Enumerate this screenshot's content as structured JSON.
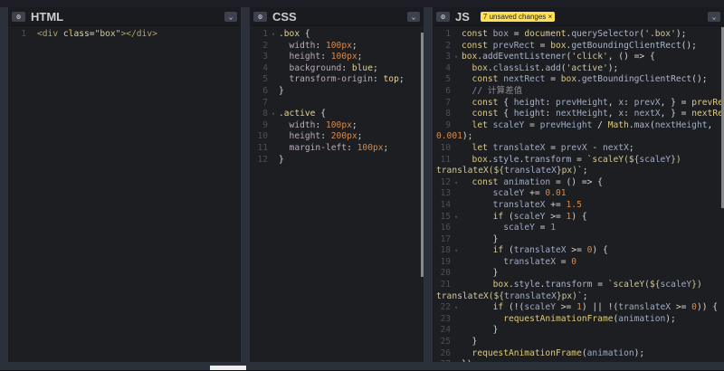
{
  "panels": [
    {
      "id": "html",
      "title": "HTML",
      "lines": [
        [
          [
            "tag",
            "<div "
          ],
          [
            "at",
            "class"
          ],
          [
            "txt",
            "="
          ],
          [
            "s",
            "\"box\""
          ],
          [
            "tag",
            "></div>"
          ]
        ]
      ]
    },
    {
      "id": "css",
      "title": "CSS",
      "lines": [
        [
          [
            "at",
            ".box"
          ],
          [
            "txt",
            " {"
          ]
        ],
        [
          [
            "p",
            "  width"
          ],
          [
            "txt",
            ": "
          ],
          [
            "n",
            "100px"
          ],
          [
            "txt",
            ";"
          ]
        ],
        [
          [
            "p",
            "  height"
          ],
          [
            "txt",
            ": "
          ],
          [
            "n",
            "100px"
          ],
          [
            "txt",
            ";"
          ]
        ],
        [
          [
            "p",
            "  background"
          ],
          [
            "txt",
            ": "
          ],
          [
            "at",
            "blue"
          ],
          [
            "txt",
            ";"
          ]
        ],
        [
          [
            "p",
            "  transform-origin"
          ],
          [
            "txt",
            ": "
          ],
          [
            "at",
            "top"
          ],
          [
            "txt",
            ";"
          ]
        ],
        [
          [
            "txt",
            "}"
          ]
        ],
        [],
        [
          [
            "at",
            ".active"
          ],
          [
            "txt",
            " {"
          ]
        ],
        [
          [
            "p",
            "  width"
          ],
          [
            "txt",
            ": "
          ],
          [
            "n",
            "100px"
          ],
          [
            "txt",
            ";"
          ]
        ],
        [
          [
            "p",
            "  height"
          ],
          [
            "txt",
            ": "
          ],
          [
            "n",
            "200px"
          ],
          [
            "txt",
            ";"
          ]
        ],
        [
          [
            "p",
            "  margin-left"
          ],
          [
            "txt",
            ": "
          ],
          [
            "n",
            "100px"
          ],
          [
            "txt",
            ";"
          ]
        ],
        [
          [
            "txt",
            "}"
          ]
        ]
      ],
      "folds": [
        1,
        8
      ]
    },
    {
      "id": "js",
      "title": "JS",
      "badge": "7 unsaved changes ×",
      "lines": [
        [
          [
            "kw",
            "const "
          ],
          [
            "v",
            "box"
          ],
          [
            "txt",
            " = "
          ],
          [
            "kw",
            "document"
          ],
          [
            "txt",
            "."
          ],
          [
            "m",
            "querySelector"
          ],
          [
            "txt",
            "("
          ],
          [
            "s",
            "'.box'"
          ],
          [
            "txt",
            ");"
          ]
        ],
        [
          [
            "kw",
            "const "
          ],
          [
            "v",
            "prevRect"
          ],
          [
            "txt",
            " = "
          ],
          [
            "kw",
            "box"
          ],
          [
            "txt",
            "."
          ],
          [
            "m",
            "getBoundingClientRect"
          ],
          [
            "txt",
            "();"
          ]
        ],
        [
          [
            "kw",
            "box"
          ],
          [
            "txt",
            "."
          ],
          [
            "m",
            "addEventListener"
          ],
          [
            "txt",
            "("
          ],
          [
            "s",
            "'click'"
          ],
          [
            "txt",
            ", () => {"
          ]
        ],
        [
          [
            "kw",
            "  box"
          ],
          [
            "txt",
            "."
          ],
          [
            "m",
            "classList"
          ],
          [
            "txt",
            "."
          ],
          [
            "m",
            "add"
          ],
          [
            "txt",
            "("
          ],
          [
            "s",
            "'active'"
          ],
          [
            "txt",
            ");"
          ]
        ],
        [
          [
            "kw",
            "  const "
          ],
          [
            "v",
            "nextRect"
          ],
          [
            "txt",
            " = "
          ],
          [
            "kw",
            "box"
          ],
          [
            "txt",
            "."
          ],
          [
            "m",
            "getBoundingClientRect"
          ],
          [
            "txt",
            "();"
          ]
        ],
        [
          [
            "c",
            "  // 计算差值"
          ]
        ],
        [
          [
            "kw",
            "  const "
          ],
          [
            "txt",
            "{ "
          ],
          [
            "m",
            "height"
          ],
          [
            "txt",
            ": "
          ],
          [
            "v",
            "prevHeight"
          ],
          [
            "txt",
            ", "
          ],
          [
            "m",
            "x"
          ],
          [
            "txt",
            ": "
          ],
          [
            "v",
            "prevX"
          ],
          [
            "txt",
            ", } = "
          ],
          [
            "kw",
            "prevRect"
          ],
          [
            "txt",
            ";"
          ]
        ],
        [
          [
            "kw",
            "  const "
          ],
          [
            "txt",
            "{ "
          ],
          [
            "m",
            "height"
          ],
          [
            "txt",
            ": "
          ],
          [
            "v",
            "nextHeight"
          ],
          [
            "txt",
            ", "
          ],
          [
            "m",
            "x"
          ],
          [
            "txt",
            ": "
          ],
          [
            "v",
            "nextX"
          ],
          [
            "txt",
            ", } = "
          ],
          [
            "kw",
            "nextRect"
          ],
          [
            "txt",
            ";"
          ]
        ],
        [
          [
            "kw",
            "  let "
          ],
          [
            "v",
            "scaleY"
          ],
          [
            "txt",
            " = "
          ],
          [
            "v",
            "prevHeight"
          ],
          [
            "txt",
            " / "
          ],
          [
            "kw",
            "Math"
          ],
          [
            "txt",
            "."
          ],
          [
            "m",
            "max"
          ],
          [
            "txt",
            "("
          ],
          [
            "v",
            "nextHeight"
          ],
          [
            "txt",
            ","
          ]
        ],
        [
          [
            "n",
            "0.001"
          ],
          [
            "txt",
            ");"
          ]
        ],
        [
          [
            "kw",
            "  let "
          ],
          [
            "v",
            "translateX"
          ],
          [
            "txt",
            " = "
          ],
          [
            "v",
            "prevX"
          ],
          [
            "txt",
            " - "
          ],
          [
            "v",
            "nextX"
          ],
          [
            "txt",
            ";"
          ]
        ],
        [
          [
            "kw",
            "  box"
          ],
          [
            "txt",
            "."
          ],
          [
            "m",
            "style"
          ],
          [
            "txt",
            "."
          ],
          [
            "m",
            "transform"
          ],
          [
            "txt",
            " = "
          ],
          [
            "s",
            "`scaleY(${"
          ],
          [
            "v",
            "scaleY"
          ],
          [
            "s",
            "})"
          ]
        ],
        [
          [
            "s",
            "translateX(${"
          ],
          [
            "v",
            "translateX"
          ],
          [
            "s",
            "}px)`"
          ],
          [
            "txt",
            ";"
          ]
        ],
        [
          [
            "kw",
            "  const "
          ],
          [
            "v",
            "animation"
          ],
          [
            "txt",
            " = () => {"
          ]
        ],
        [
          [
            "v",
            "      scaleY"
          ],
          [
            "txt",
            " += "
          ],
          [
            "n",
            "0.01"
          ]
        ],
        [
          [
            "v",
            "      translateX"
          ],
          [
            "txt",
            " += "
          ],
          [
            "n",
            "1.5"
          ]
        ],
        [
          [
            "kw",
            "      if "
          ],
          [
            "txt",
            "("
          ],
          [
            "v",
            "scaleY"
          ],
          [
            "txt",
            " >= "
          ],
          [
            "n",
            "1"
          ],
          [
            "txt",
            ") {"
          ]
        ],
        [
          [
            "v",
            "        scaleY"
          ],
          [
            "txt",
            " = "
          ],
          [
            "n",
            "1"
          ]
        ],
        [
          [
            "txt",
            "      }"
          ]
        ],
        [
          [
            "kw",
            "      if "
          ],
          [
            "txt",
            "("
          ],
          [
            "v",
            "translateX"
          ],
          [
            "txt",
            " >= "
          ],
          [
            "n",
            "0"
          ],
          [
            "txt",
            ") {"
          ]
        ],
        [
          [
            "v",
            "        translateX"
          ],
          [
            "txt",
            " = "
          ],
          [
            "n",
            "0"
          ]
        ],
        [
          [
            "txt",
            "      }"
          ]
        ],
        [
          [
            "kw",
            "      box"
          ],
          [
            "txt",
            "."
          ],
          [
            "m",
            "style"
          ],
          [
            "txt",
            "."
          ],
          [
            "m",
            "transform"
          ],
          [
            "txt",
            " = "
          ],
          [
            "s",
            "`scaleY(${"
          ],
          [
            "v",
            "scaleY"
          ],
          [
            "s",
            "})"
          ]
        ],
        [
          [
            "s",
            "translateX(${"
          ],
          [
            "v",
            "translateX"
          ],
          [
            "s",
            "}px)`"
          ],
          [
            "txt",
            ";"
          ]
        ],
        [
          [
            "kw",
            "      if "
          ],
          [
            "txt",
            "(!("
          ],
          [
            "v",
            "scaleY"
          ],
          [
            "txt",
            " >= "
          ],
          [
            "n",
            "1"
          ],
          [
            "txt",
            ") || !("
          ],
          [
            "v",
            "translateX"
          ],
          [
            "txt",
            " >= "
          ],
          [
            "n",
            "0"
          ],
          [
            "txt",
            ")) {"
          ]
        ],
        [
          [
            "kw",
            "        requestAnimationFrame"
          ],
          [
            "txt",
            "("
          ],
          [
            "v",
            "animation"
          ],
          [
            "txt",
            ");"
          ]
        ],
        [
          [
            "txt",
            "      }"
          ]
        ],
        [
          [
            "txt",
            "  }"
          ]
        ],
        [
          [
            "kw",
            "  requestAnimationFrame"
          ],
          [
            "txt",
            "("
          ],
          [
            "v",
            "animation"
          ],
          [
            "txt",
            ");"
          ]
        ],
        [
          [
            "txt",
            "});"
          ]
        ]
      ],
      "numbers": [
        1,
        2,
        3,
        4,
        5,
        6,
        7,
        8,
        9,
        "",
        10,
        11,
        "",
        12,
        13,
        14,
        15,
        16,
        17,
        18,
        19,
        20,
        21,
        "",
        22,
        23,
        24,
        25,
        26,
        27
      ],
      "folds": [
        3,
        12,
        15,
        18,
        22
      ]
    }
  ],
  "icons": {
    "settings": "gear-icon",
    "collapse": "chevron-down-icon"
  }
}
